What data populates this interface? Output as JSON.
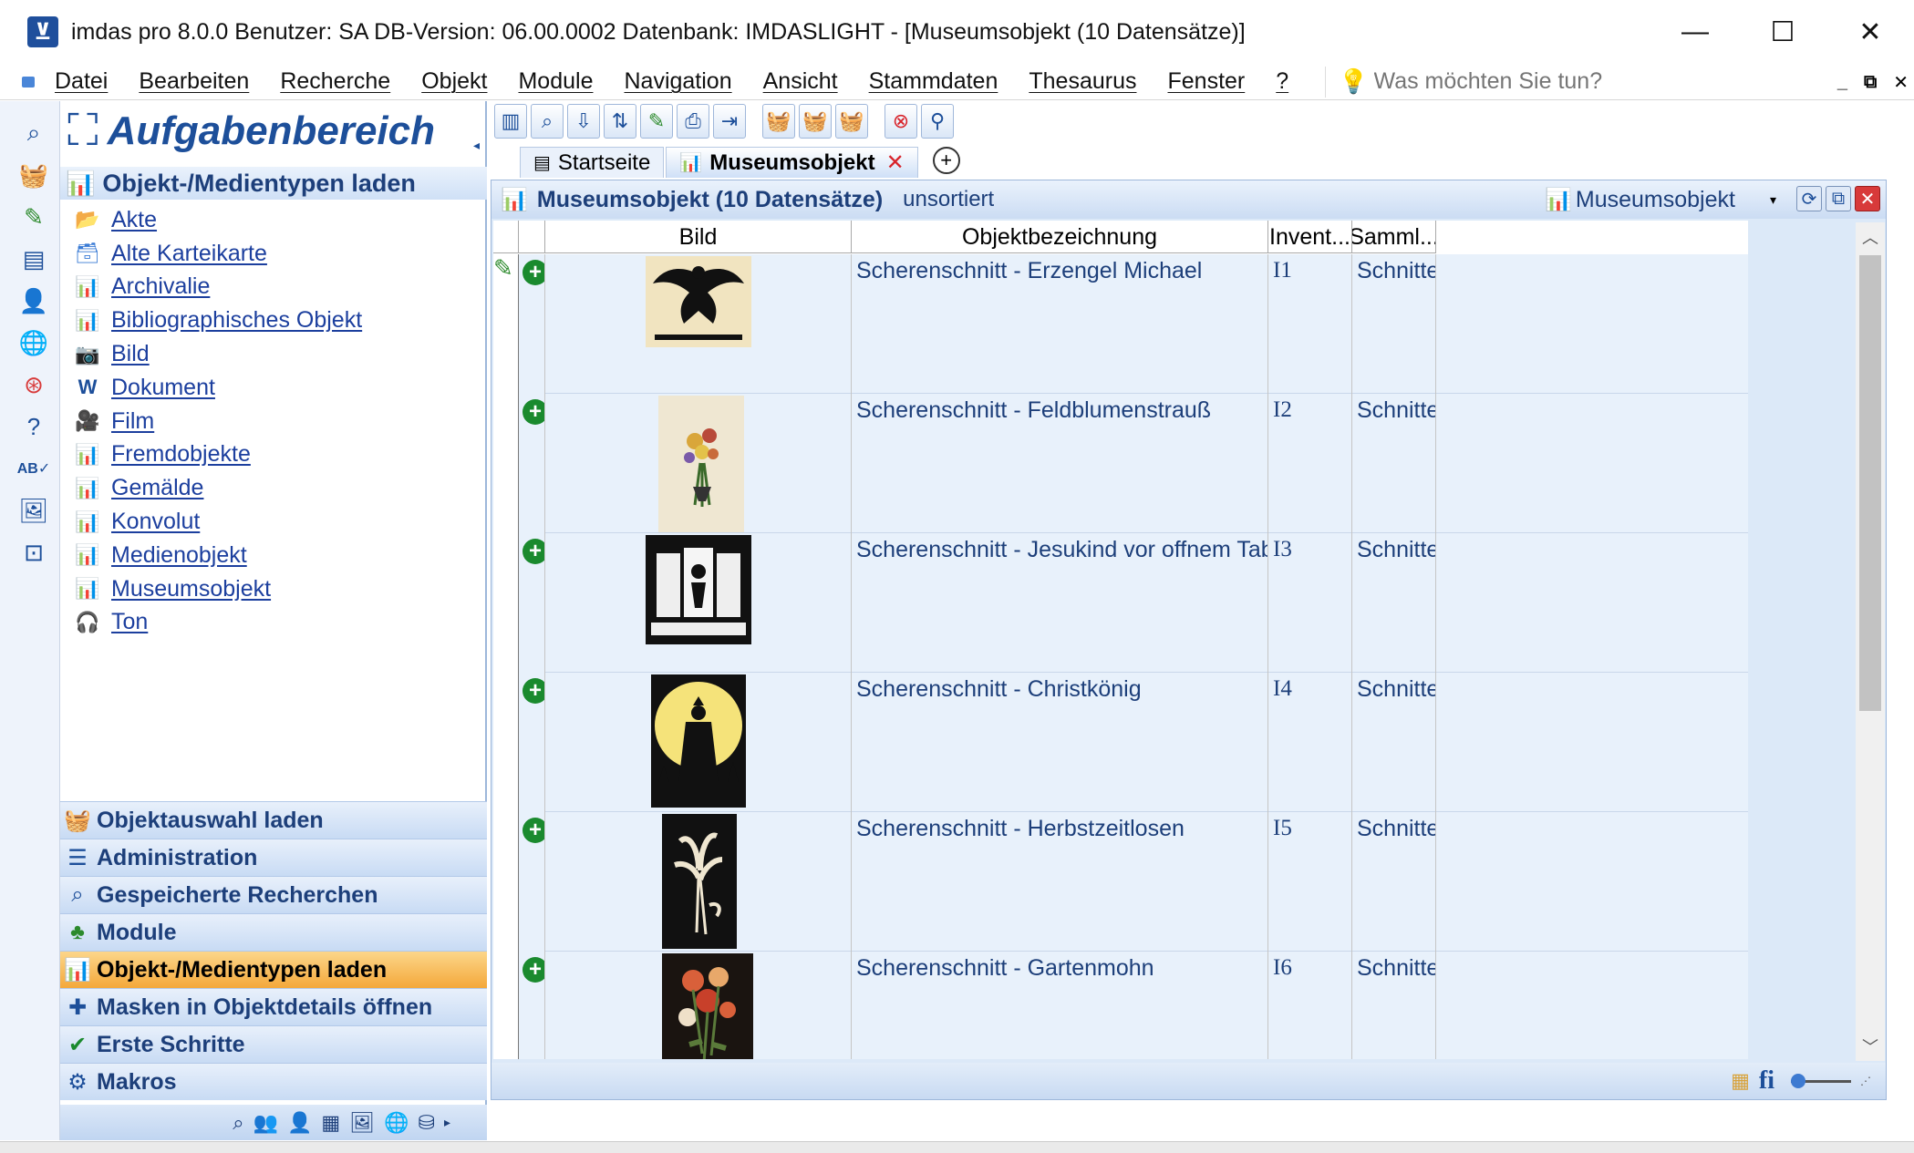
{
  "window": {
    "title": "imdas pro 8.0.0 Benutzer: SA   DB-Version: 06.00.0002   Datenbank: IMDASLIGHT - [Museumsobjekt (10 Datensätze)]",
    "minimize": "—",
    "maximize": "☐",
    "close": "✕"
  },
  "menu": {
    "items": [
      "Datei",
      "Bearbeiten",
      "Recherche",
      "Objekt",
      "Module",
      "Navigation",
      "Ansicht",
      "Stammdaten",
      "Thesaurus",
      "Fenster",
      "?"
    ],
    "tellme_placeholder": "Was möchten Sie tun?"
  },
  "taskpane": {
    "title": "Aufgabenbereich",
    "section": "Objekt-/Medientypen laden",
    "types": [
      {
        "label": "Akte",
        "icon": "folder-icon"
      },
      {
        "label": "Alte Karteikarte",
        "icon": "card-box-icon"
      },
      {
        "label": "Archivalie",
        "icon": "chart-icon"
      },
      {
        "label": "Bibliographisches Objekt",
        "icon": "chart-icon"
      },
      {
        "label": "Bild",
        "icon": "camera-icon"
      },
      {
        "label": "Dokument",
        "icon": "word-icon"
      },
      {
        "label": "Film",
        "icon": "video-icon"
      },
      {
        "label": "Fremdobjekte",
        "icon": "chart-icon"
      },
      {
        "label": "Gemälde",
        "icon": "chart-icon"
      },
      {
        "label": "Konvolut",
        "icon": "chart-icon"
      },
      {
        "label": "Medienobjekt",
        "icon": "chart-icon"
      },
      {
        "label": "Museumsobjekt",
        "icon": "chart-icon"
      },
      {
        "label": "Ton",
        "icon": "headphones-icon"
      }
    ],
    "nav": [
      {
        "label": "Objektauswahl laden",
        "icon": "basket-icon"
      },
      {
        "label": "Administration",
        "icon": "checklist-icon"
      },
      {
        "label": "Gespeicherte Recherchen",
        "icon": "search-icon"
      },
      {
        "label": "Module",
        "icon": "blocks-icon"
      },
      {
        "label": "Objekt-/Medientypen laden",
        "icon": "chart-icon",
        "active": true
      },
      {
        "label": "Masken in Objektdetails öffnen",
        "icon": "puzzle-icon"
      },
      {
        "label": "Erste Schritte",
        "icon": "check-circle-icon"
      },
      {
        "label": "Makros",
        "icon": "gear-icon"
      }
    ]
  },
  "tabs": [
    {
      "label": "Startseite",
      "active": false
    },
    {
      "label": "Museumsobjekt",
      "active": true
    }
  ],
  "content": {
    "title": "Museumsobjekt (10 Datensätze)",
    "sort": "unsortiert",
    "objtype": "Museumsobjekt",
    "columns": [
      "Bild",
      "Objektbezeichnung",
      "Invent...",
      "Samml..."
    ],
    "rows": [
      {
        "name": "Scherenschnitt - Erzengel Michael",
        "inv": "I1",
        "coll": "Schnitte",
        "thumb": "light"
      },
      {
        "name": "Scherenschnitt - Feldblumenstrauß",
        "inv": "I2",
        "coll": "Schnitte",
        "thumb": "light"
      },
      {
        "name": "Scherenschnitt - Jesukind vor offnem Tabernakel",
        "inv": "I3",
        "coll": "Schnitte",
        "thumb": "dark"
      },
      {
        "name": "Scherenschnitt - Christkönig",
        "inv": "I4",
        "coll": "Schnitte",
        "thumb": "yellow"
      },
      {
        "name": "Scherenschnitt - Herbstzeitlosen",
        "inv": "I5",
        "coll": "Schnitte",
        "thumb": "dark"
      },
      {
        "name": "Scherenschnitt - Gartenmohn",
        "inv": "I6",
        "coll": "Schnitte",
        "thumb": "dark"
      }
    ]
  },
  "colors": {
    "accent": "#1d4f9a",
    "active_nav": "#f4a83a",
    "type_icon": "#d8232a"
  }
}
